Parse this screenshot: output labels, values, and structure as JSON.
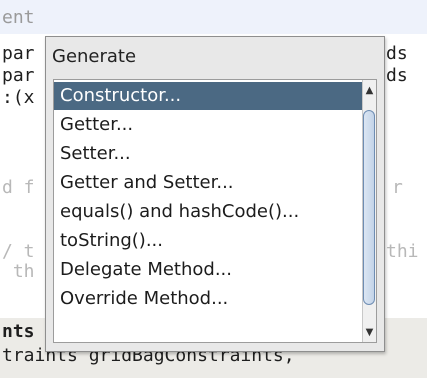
{
  "editor": {
    "lines": [
      "ent",
      "par",
      "par",
      ":(x",
      "d f",
      "/ t",
      " th",
      "nts",
      "traints gridBagConstraints,"
    ],
    "right_fragments": [
      "ds",
      "ds",
      "r",
      "thi"
    ]
  },
  "popup": {
    "title": "Generate",
    "items": [
      "Constructor...",
      "Getter...",
      "Setter...",
      "Getter and Setter...",
      "equals() and hashCode()...",
      "toString()...",
      "Delegate Method...",
      "Override Method..."
    ],
    "selected_index": 0,
    "scroll_up_glyph": "▲",
    "scroll_down_glyph": "▼"
  }
}
